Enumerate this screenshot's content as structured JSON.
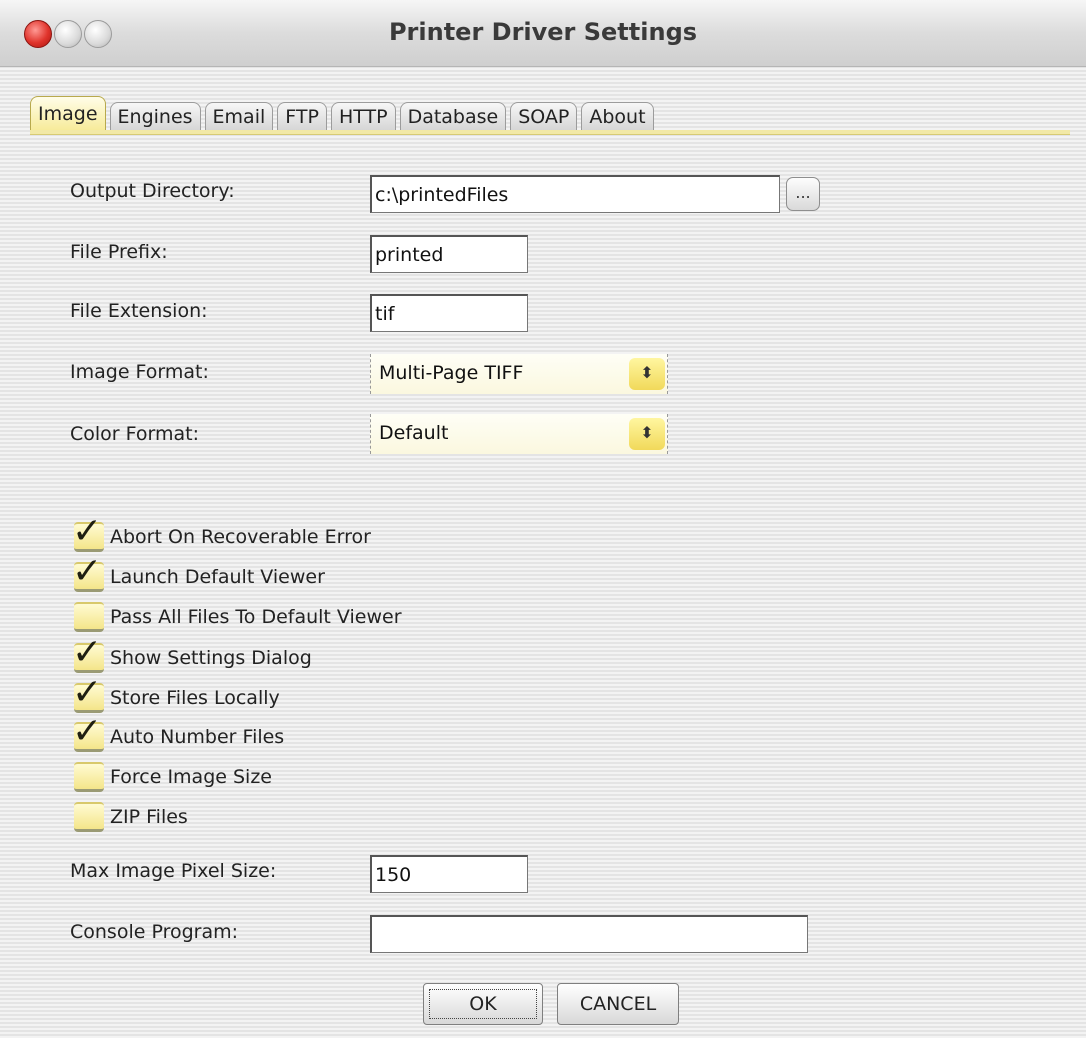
{
  "window": {
    "title": "Printer Driver Settings"
  },
  "tabs": [
    {
      "label": "Image",
      "active": true
    },
    {
      "label": "Engines"
    },
    {
      "label": "Email"
    },
    {
      "label": "FTP"
    },
    {
      "label": "HTTP"
    },
    {
      "label": "Database"
    },
    {
      "label": "SOAP"
    },
    {
      "label": "About"
    }
  ],
  "fields": {
    "output_directory": {
      "label": "Output Directory:",
      "value": "c:\\printedFiles",
      "browse_label": "..."
    },
    "file_prefix": {
      "label": "File Prefix:",
      "value": "printed"
    },
    "file_extension": {
      "label": "File Extension:",
      "value": "tif"
    },
    "image_format": {
      "label": "Image Format:",
      "value": "Multi-Page TIFF"
    },
    "color_format": {
      "label": "Color Format:",
      "value": "Default"
    },
    "max_image_pixel_size": {
      "label": "Max Image Pixel Size:",
      "value": "150"
    },
    "console_program": {
      "label": "Console Program:",
      "value": ""
    }
  },
  "checkboxes": [
    {
      "label": "Abort On Recoverable Error",
      "checked": true
    },
    {
      "label": "Launch Default Viewer",
      "checked": true
    },
    {
      "label": "Pass All Files To Default Viewer",
      "checked": false
    },
    {
      "label": "Show Settings Dialog",
      "checked": true
    },
    {
      "label": "Store Files Locally",
      "checked": true
    },
    {
      "label": "Auto Number Files",
      "checked": true
    },
    {
      "label": "Force Image Size",
      "checked": false
    },
    {
      "label": "ZIP Files",
      "checked": false
    }
  ],
  "buttons": {
    "ok": "OK",
    "cancel": "CANCEL"
  },
  "glyphs": {
    "check": "✓",
    "select_arrow": "⬍"
  },
  "colors": {
    "active_tab": "#f7eb9a",
    "checkbox": "#f4e58a",
    "close_button": "#e0342c"
  }
}
